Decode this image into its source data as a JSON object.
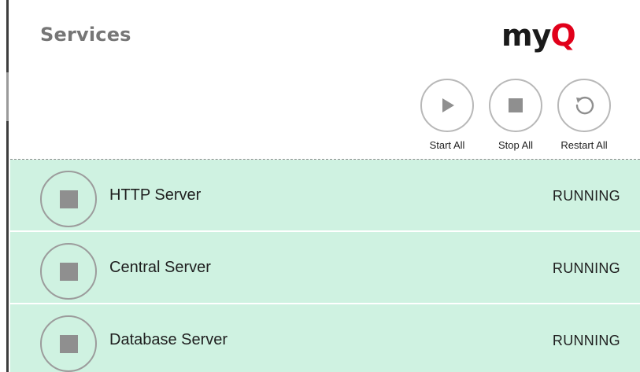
{
  "header": {
    "title": "Services",
    "logo": {
      "my": "my",
      "q": "Q"
    }
  },
  "toolbar": {
    "start_label": "Start All",
    "stop_label": "Stop All",
    "restart_label": "Restart All"
  },
  "services": [
    {
      "name": "HTTP Server",
      "status": "RUNNING"
    },
    {
      "name": "Central Server",
      "status": "RUNNING"
    },
    {
      "name": "Database Server",
      "status": "RUNNING"
    }
  ],
  "colors": {
    "row_running": "#cff2e1",
    "brand_red": "#e1001a"
  }
}
